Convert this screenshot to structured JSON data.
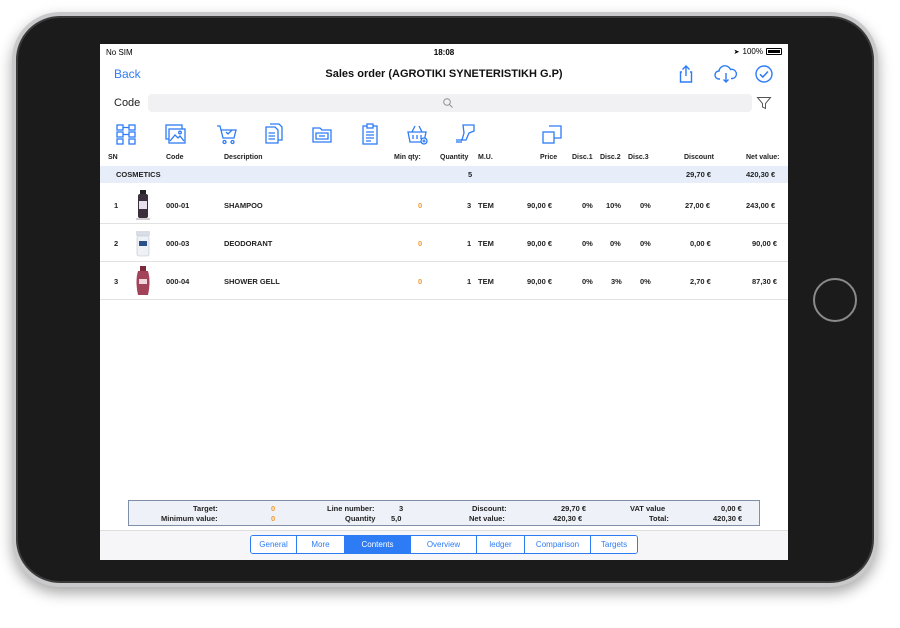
{
  "status": {
    "carrier": "No SIM",
    "time": "18:08",
    "battery": "100%"
  },
  "nav": {
    "back": "Back",
    "title": "Sales order (AGROTIKI SYNETERISTIKH G.P)"
  },
  "search": {
    "label": "Code",
    "placeholder": ""
  },
  "columns": {
    "sn": "SN",
    "code": "Code",
    "description": "Description",
    "min_qty": "Min qty:",
    "quantity": "Quantity",
    "mu": "M.U.",
    "price": "Price",
    "disc1": "Disc.1",
    "disc2": "Disc.2",
    "disc3": "Disc.3",
    "discount": "Discount",
    "net_value": "Net value:"
  },
  "group": {
    "name": "COSMETICS",
    "quantity": "5",
    "discount": "29,70 €",
    "net_value": "420,30 €"
  },
  "rows": [
    {
      "sn": "1",
      "code": "000-01",
      "description": "SHAMPOO",
      "min_qty": "0",
      "quantity": "3",
      "mu": "TEM",
      "price": "90,00 €",
      "disc1": "0%",
      "disc2": "10%",
      "disc3": "0%",
      "discount": "27,00 €",
      "net_value": "243,00 €"
    },
    {
      "sn": "2",
      "code": "000-03",
      "description": "DEODORANT",
      "min_qty": "0",
      "quantity": "1",
      "mu": "TEM",
      "price": "90,00 €",
      "disc1": "0%",
      "disc2": "0%",
      "disc3": "0%",
      "discount": "0,00 €",
      "net_value": "90,00 €"
    },
    {
      "sn": "3",
      "code": "000-04",
      "description": "SHOWER GELL",
      "min_qty": "0",
      "quantity": "1",
      "mu": "TEM",
      "price": "90,00 €",
      "disc1": "0%",
      "disc2": "3%",
      "disc3": "0%",
      "discount": "2,70 €",
      "net_value": "87,30 €"
    }
  ],
  "totals": {
    "target_label": "Target:",
    "target": "0",
    "min_value_label": "Minimum value:",
    "min_value": "0",
    "line_number_label": "Line number:",
    "line_number": "3",
    "quantity_label": "Quantity",
    "quantity": "5,0",
    "discount_label": "Discount:",
    "discount": "29,70 €",
    "net_value_label": "Net value:",
    "net_value": "420,30 €",
    "vat_label": "VAT value",
    "vat": "0,00 €",
    "total_label": "Total:",
    "total": "420,30 €"
  },
  "tabs": [
    {
      "label": "General",
      "active": false
    },
    {
      "label": "More",
      "active": false
    },
    {
      "label": "Contents",
      "active": true
    },
    {
      "label": "Overview",
      "active": false
    },
    {
      "label": "ledger",
      "active": false
    },
    {
      "label": "Comparison",
      "active": false
    },
    {
      "label": "Targets",
      "active": false
    }
  ],
  "icons": {
    "share": "share-icon",
    "cloud": "cloud-download-icon",
    "check": "checkmark-circle-icon",
    "search": "search-icon",
    "filter": "filter-icon"
  },
  "colors": {
    "accent": "#2d7cf6",
    "orange": "#f29a2e",
    "group_bg": "#e7eef9"
  }
}
